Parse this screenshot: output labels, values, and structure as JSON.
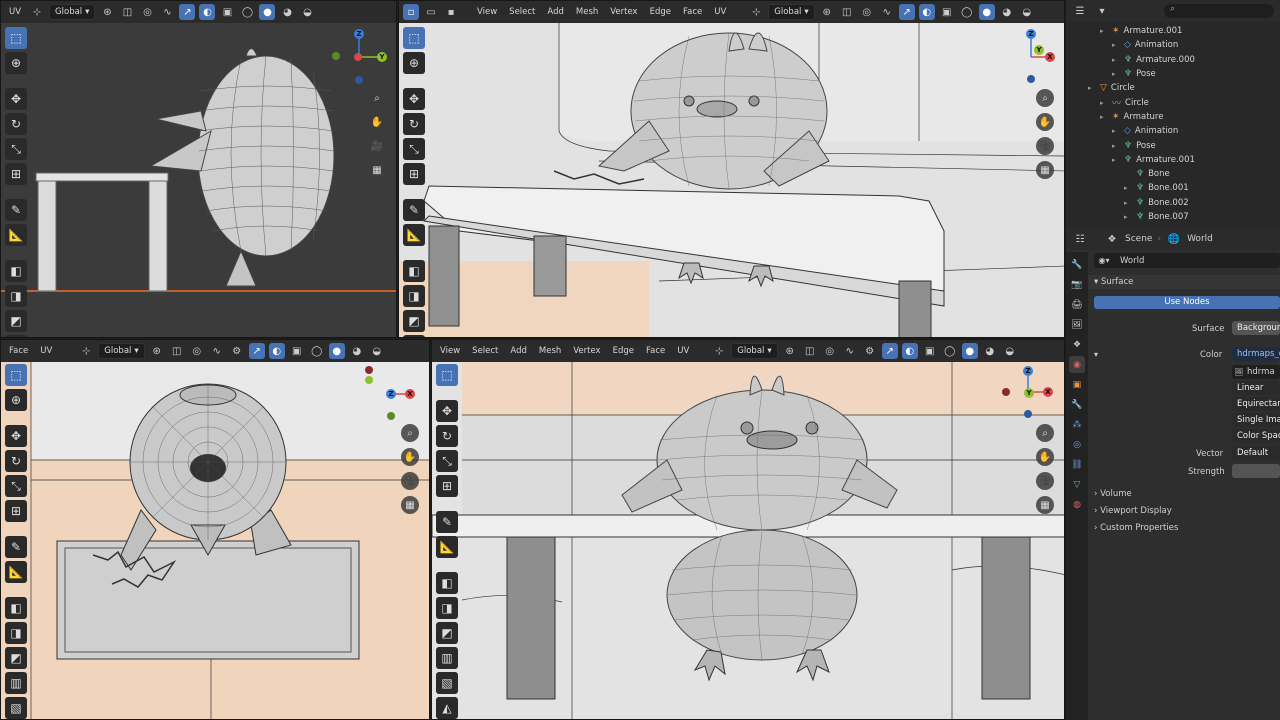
{
  "viewport_tl": {
    "menu_uv": "UV",
    "orientation": "Global"
  },
  "viewport_tr": {
    "menus": [
      "View",
      "Select",
      "Add",
      "Mesh",
      "Vertex",
      "Edge",
      "Face",
      "UV"
    ],
    "orientation": "Global"
  },
  "viewport_bl": {
    "menus": [
      "Face",
      "UV"
    ],
    "orientation": "Global"
  },
  "viewport_br": {
    "menus": [
      "View",
      "Select",
      "Add",
      "Mesh",
      "Vertex",
      "Edge",
      "Face",
      "UV"
    ],
    "orientation": "Global"
  },
  "gizmo_labels": {
    "z": "Z",
    "y": "Y",
    "x": "X"
  },
  "outliner": {
    "items": [
      {
        "label": "Armature.001",
        "indent": 1,
        "icon": "armature-icon"
      },
      {
        "label": "Animation",
        "indent": 2,
        "icon": "animation-icon"
      },
      {
        "label": "Armature.000",
        "indent": 2,
        "icon": "armature-data-icon"
      },
      {
        "label": "Pose",
        "indent": 2,
        "icon": "pose-icon"
      },
      {
        "label": "Circle",
        "indent": 0,
        "icon": "curve-object-icon"
      },
      {
        "label": "Circle",
        "indent": 1,
        "icon": "curve-data-icon"
      },
      {
        "label": "Armature",
        "indent": 1,
        "icon": "armature-icon"
      },
      {
        "label": "Animation",
        "indent": 2,
        "icon": "animation-icon"
      },
      {
        "label": "Pose",
        "indent": 2,
        "icon": "pose-icon"
      },
      {
        "label": "Armature.001",
        "indent": 2,
        "icon": "armature-data-icon"
      },
      {
        "label": "Bone",
        "indent": 3,
        "icon": "bone-icon"
      },
      {
        "label": "Bone.001",
        "indent": 3,
        "icon": "bone-icon"
      },
      {
        "label": "Bone.002",
        "indent": 3,
        "icon": "bone-icon"
      },
      {
        "label": "Bone.007",
        "indent": 3,
        "icon": "bone-icon"
      }
    ]
  },
  "properties": {
    "breadcrumb_scene": "Scene",
    "breadcrumb_world": "World",
    "world_name": "World",
    "surface_panel": "Surface",
    "use_nodes": "Use Nodes",
    "surface_label": "Surface",
    "surface_value": "Background",
    "color_label": "Color",
    "color_value": "hdrmaps_co",
    "image_name": "hdrma",
    "interpolation": "Linear",
    "projection": "Equirectang",
    "source": "Single Image",
    "color_space": "Color Space",
    "vector_label": "Vector",
    "vector_value": "Default",
    "strength_label": "Strength",
    "volume_panel": "Volume",
    "viewport_display_panel": "Viewport Display",
    "custom_props_panel": "Custom Properties"
  }
}
